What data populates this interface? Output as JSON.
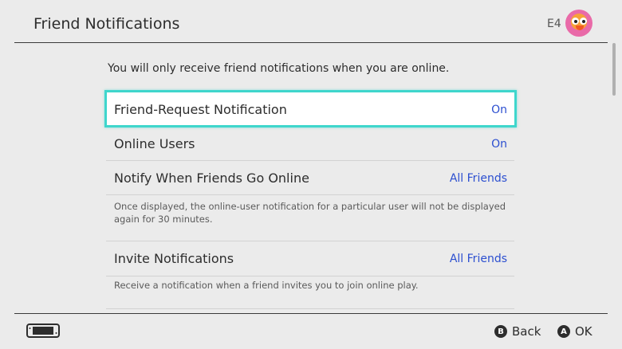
{
  "header": {
    "title": "Friend Notifications",
    "user_code": "E4"
  },
  "intro": "You will only receive friend notifications when you are online.",
  "settings": [
    {
      "label": "Friend-Request Notification",
      "value": "On"
    },
    {
      "label": "Online Users",
      "value": "On"
    },
    {
      "label": "Notify When Friends Go Online",
      "value": "All Friends"
    },
    {
      "label": "Invite Notifications",
      "value": "All Friends"
    }
  ],
  "descriptions": {
    "notify_online": "Once displayed, the online-user notification for a particular user will not be displayed again for 30 minutes.",
    "invite": "Receive a notification when a friend invites you to join online play."
  },
  "footer": {
    "back_key": "B",
    "back_label": "Back",
    "ok_key": "A",
    "ok_label": "OK"
  },
  "colors": {
    "selection": "#3fd6cc",
    "value_text": "#2c4fd0",
    "background": "#ebebeb"
  }
}
